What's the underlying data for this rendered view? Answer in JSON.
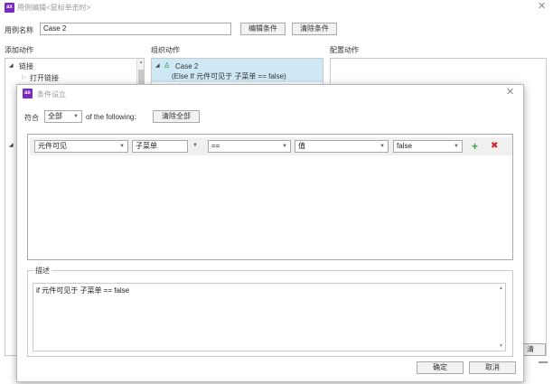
{
  "window": {
    "title": "用例编辑<鼠标单击时>",
    "icon_text": "ax"
  },
  "case_name": {
    "label": "用例名称",
    "value": "Case 2",
    "edit_button": "编辑条件",
    "clear_button": "清除条件"
  },
  "columns": {
    "add_actions": "添加动作",
    "organize_actions": "组织动作",
    "configure_actions": "配置动作"
  },
  "actions_tree": {
    "links_label": "链接",
    "open_link_label": "打开链接"
  },
  "organize_tree": {
    "case_label": "Case 2",
    "case_condition": "(Else If 元件可见于 子菜单 == false)"
  },
  "background_button_fragment": "清",
  "dialog": {
    "title": "条件设立",
    "match_label": "符合",
    "match_value": "全部",
    "of_following": "of the following:",
    "clear_all": "清除全部",
    "condition": {
      "type": "元件可见",
      "target": "子菜单",
      "operator": "==",
      "value_type": "值",
      "value": "false"
    },
    "description_label": "描述",
    "description_text": "if 元件可见于 子菜单 == false",
    "ok": "确定",
    "cancel": "取消"
  }
}
